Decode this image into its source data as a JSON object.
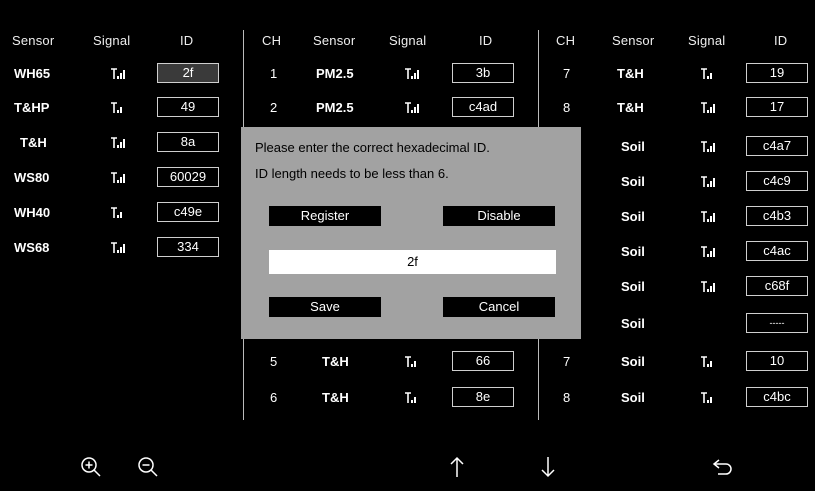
{
  "headers": {
    "col1": {
      "sensor": "Sensor",
      "signal": "Signal",
      "id": "ID"
    },
    "col2": {
      "ch": "CH",
      "sensor": "Sensor",
      "signal": "Signal",
      "id": "ID"
    },
    "col3": {
      "ch": "CH",
      "sensor": "Sensor",
      "signal": "Signal",
      "id": "ID"
    }
  },
  "col1_rows": [
    {
      "sensor": "WH65",
      "id": "2f",
      "signal_bars": 4,
      "selected": true
    },
    {
      "sensor": "T&HP",
      "id": "49",
      "signal_bars": 3
    },
    {
      "sensor": "T&H",
      "id": "8a",
      "signal_bars": 4
    },
    {
      "sensor": "WS80",
      "id": "60029",
      "signal_bars": 4
    },
    {
      "sensor": "WH40",
      "id": "c49e",
      "signal_bars": 3
    },
    {
      "sensor": "WS68",
      "id": "334",
      "signal_bars": 4
    }
  ],
  "col2_rows": [
    {
      "ch": "1",
      "sensor": "PM2.5",
      "id": "3b",
      "signal_bars": 4
    },
    {
      "ch": "2",
      "sensor": "PM2.5",
      "id": "c4ad",
      "signal_bars": 4
    },
    {
      "ch": "5",
      "sensor": "T&H",
      "id": "66",
      "signal_bars": 3
    },
    {
      "ch": "6",
      "sensor": "T&H",
      "id": "8e",
      "signal_bars": 3
    }
  ],
  "col3_rows": [
    {
      "ch": "7",
      "sensor": "T&H",
      "id": "19",
      "signal_bars": 3
    },
    {
      "ch": "8",
      "sensor": "T&H",
      "id": "17",
      "signal_bars": 4
    },
    {
      "ch": "",
      "sensor": "Soil",
      "id": "c4a7",
      "signal_bars": 4
    },
    {
      "ch": "",
      "sensor": "Soil",
      "id": "c4c9",
      "signal_bars": 4
    },
    {
      "ch": "",
      "sensor": "Soil",
      "id": "c4b3",
      "signal_bars": 4
    },
    {
      "ch": "",
      "sensor": "Soil",
      "id": "c4ac",
      "signal_bars": 4
    },
    {
      "ch": "",
      "sensor": "Soil",
      "id": "c68f",
      "signal_bars": 4
    },
    {
      "ch": "",
      "sensor": "Soil",
      "id": "-----",
      "signal_bars": 0
    },
    {
      "ch": "7",
      "sensor": "Soil",
      "id": "10",
      "signal_bars": 3
    },
    {
      "ch": "8",
      "sensor": "Soil",
      "id": "c4bc",
      "signal_bars": 3
    }
  ],
  "dialog": {
    "message_line1": "Please enter the correct hexadecimal ID.",
    "message_line2": "ID length needs to be less than 6.",
    "register_label": "Register",
    "disable_label": "Disable",
    "input_value": "2f",
    "save_label": "Save",
    "cancel_label": "Cancel"
  },
  "bottom_bar": {
    "zoom_in": "zoom-in-icon",
    "zoom_out": "zoom-out-icon",
    "up": "arrow-up-icon",
    "down": "arrow-down-icon",
    "back": "back-icon"
  },
  "colors": {
    "background": "#000000",
    "dialog_bg": "#a2a2a2",
    "button_bg": "#000000",
    "text": "#ffffff"
  }
}
